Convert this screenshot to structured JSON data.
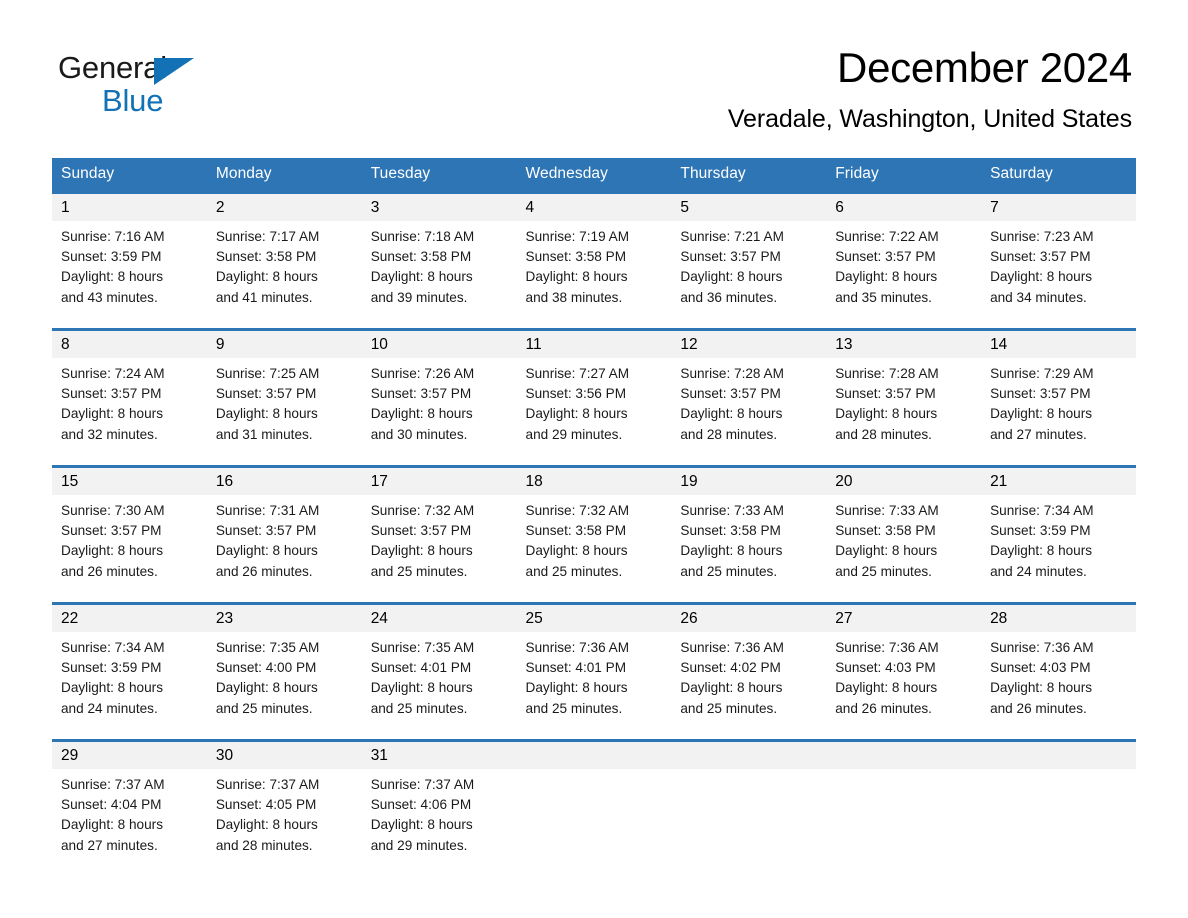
{
  "logo": {
    "word1": "General",
    "word2": "Blue",
    "triangle_color": "#1371b5"
  },
  "header": {
    "title": "December 2024",
    "location": "Veradale, Washington, United States"
  },
  "theme": {
    "header_blue": "#2e75b6",
    "daynum_gray": "#f2f2f2",
    "text_black": "#000000"
  },
  "calendar": {
    "weekday_headers": [
      "Sunday",
      "Monday",
      "Tuesday",
      "Wednesday",
      "Thursday",
      "Friday",
      "Saturday"
    ],
    "weeks": [
      [
        {
          "day": "1",
          "sunrise": "Sunrise: 7:16 AM",
          "sunset": "Sunset: 3:59 PM",
          "daylight1": "Daylight: 8 hours",
          "daylight2": "and 43 minutes."
        },
        {
          "day": "2",
          "sunrise": "Sunrise: 7:17 AM",
          "sunset": "Sunset: 3:58 PM",
          "daylight1": "Daylight: 8 hours",
          "daylight2": "and 41 minutes."
        },
        {
          "day": "3",
          "sunrise": "Sunrise: 7:18 AM",
          "sunset": "Sunset: 3:58 PM",
          "daylight1": "Daylight: 8 hours",
          "daylight2": "and 39 minutes."
        },
        {
          "day": "4",
          "sunrise": "Sunrise: 7:19 AM",
          "sunset": "Sunset: 3:58 PM",
          "daylight1": "Daylight: 8 hours",
          "daylight2": "and 38 minutes."
        },
        {
          "day": "5",
          "sunrise": "Sunrise: 7:21 AM",
          "sunset": "Sunset: 3:57 PM",
          "daylight1": "Daylight: 8 hours",
          "daylight2": "and 36 minutes."
        },
        {
          "day": "6",
          "sunrise": "Sunrise: 7:22 AM",
          "sunset": "Sunset: 3:57 PM",
          "daylight1": "Daylight: 8 hours",
          "daylight2": "and 35 minutes."
        },
        {
          "day": "7",
          "sunrise": "Sunrise: 7:23 AM",
          "sunset": "Sunset: 3:57 PM",
          "daylight1": "Daylight: 8 hours",
          "daylight2": "and 34 minutes."
        }
      ],
      [
        {
          "day": "8",
          "sunrise": "Sunrise: 7:24 AM",
          "sunset": "Sunset: 3:57 PM",
          "daylight1": "Daylight: 8 hours",
          "daylight2": "and 32 minutes."
        },
        {
          "day": "9",
          "sunrise": "Sunrise: 7:25 AM",
          "sunset": "Sunset: 3:57 PM",
          "daylight1": "Daylight: 8 hours",
          "daylight2": "and 31 minutes."
        },
        {
          "day": "10",
          "sunrise": "Sunrise: 7:26 AM",
          "sunset": "Sunset: 3:57 PM",
          "daylight1": "Daylight: 8 hours",
          "daylight2": "and 30 minutes."
        },
        {
          "day": "11",
          "sunrise": "Sunrise: 7:27 AM",
          "sunset": "Sunset: 3:56 PM",
          "daylight1": "Daylight: 8 hours",
          "daylight2": "and 29 minutes."
        },
        {
          "day": "12",
          "sunrise": "Sunrise: 7:28 AM",
          "sunset": "Sunset: 3:57 PM",
          "daylight1": "Daylight: 8 hours",
          "daylight2": "and 28 minutes."
        },
        {
          "day": "13",
          "sunrise": "Sunrise: 7:28 AM",
          "sunset": "Sunset: 3:57 PM",
          "daylight1": "Daylight: 8 hours",
          "daylight2": "and 28 minutes."
        },
        {
          "day": "14",
          "sunrise": "Sunrise: 7:29 AM",
          "sunset": "Sunset: 3:57 PM",
          "daylight1": "Daylight: 8 hours",
          "daylight2": "and 27 minutes."
        }
      ],
      [
        {
          "day": "15",
          "sunrise": "Sunrise: 7:30 AM",
          "sunset": "Sunset: 3:57 PM",
          "daylight1": "Daylight: 8 hours",
          "daylight2": "and 26 minutes."
        },
        {
          "day": "16",
          "sunrise": "Sunrise: 7:31 AM",
          "sunset": "Sunset: 3:57 PM",
          "daylight1": "Daylight: 8 hours",
          "daylight2": "and 26 minutes."
        },
        {
          "day": "17",
          "sunrise": "Sunrise: 7:32 AM",
          "sunset": "Sunset: 3:57 PM",
          "daylight1": "Daylight: 8 hours",
          "daylight2": "and 25 minutes."
        },
        {
          "day": "18",
          "sunrise": "Sunrise: 7:32 AM",
          "sunset": "Sunset: 3:58 PM",
          "daylight1": "Daylight: 8 hours",
          "daylight2": "and 25 minutes."
        },
        {
          "day": "19",
          "sunrise": "Sunrise: 7:33 AM",
          "sunset": "Sunset: 3:58 PM",
          "daylight1": "Daylight: 8 hours",
          "daylight2": "and 25 minutes."
        },
        {
          "day": "20",
          "sunrise": "Sunrise: 7:33 AM",
          "sunset": "Sunset: 3:58 PM",
          "daylight1": "Daylight: 8 hours",
          "daylight2": "and 25 minutes."
        },
        {
          "day": "21",
          "sunrise": "Sunrise: 7:34 AM",
          "sunset": "Sunset: 3:59 PM",
          "daylight1": "Daylight: 8 hours",
          "daylight2": "and 24 minutes."
        }
      ],
      [
        {
          "day": "22",
          "sunrise": "Sunrise: 7:34 AM",
          "sunset": "Sunset: 3:59 PM",
          "daylight1": "Daylight: 8 hours",
          "daylight2": "and 24 minutes."
        },
        {
          "day": "23",
          "sunrise": "Sunrise: 7:35 AM",
          "sunset": "Sunset: 4:00 PM",
          "daylight1": "Daylight: 8 hours",
          "daylight2": "and 25 minutes."
        },
        {
          "day": "24",
          "sunrise": "Sunrise: 7:35 AM",
          "sunset": "Sunset: 4:01 PM",
          "daylight1": "Daylight: 8 hours",
          "daylight2": "and 25 minutes."
        },
        {
          "day": "25",
          "sunrise": "Sunrise: 7:36 AM",
          "sunset": "Sunset: 4:01 PM",
          "daylight1": "Daylight: 8 hours",
          "daylight2": "and 25 minutes."
        },
        {
          "day": "26",
          "sunrise": "Sunrise: 7:36 AM",
          "sunset": "Sunset: 4:02 PM",
          "daylight1": "Daylight: 8 hours",
          "daylight2": "and 25 minutes."
        },
        {
          "day": "27",
          "sunrise": "Sunrise: 7:36 AM",
          "sunset": "Sunset: 4:03 PM",
          "daylight1": "Daylight: 8 hours",
          "daylight2": "and 26 minutes."
        },
        {
          "day": "28",
          "sunrise": "Sunrise: 7:36 AM",
          "sunset": "Sunset: 4:03 PM",
          "daylight1": "Daylight: 8 hours",
          "daylight2": "and 26 minutes."
        }
      ],
      [
        {
          "day": "29",
          "sunrise": "Sunrise: 7:37 AM",
          "sunset": "Sunset: 4:04 PM",
          "daylight1": "Daylight: 8 hours",
          "daylight2": "and 27 minutes."
        },
        {
          "day": "30",
          "sunrise": "Sunrise: 7:37 AM",
          "sunset": "Sunset: 4:05 PM",
          "daylight1": "Daylight: 8 hours",
          "daylight2": "and 28 minutes."
        },
        {
          "day": "31",
          "sunrise": "Sunrise: 7:37 AM",
          "sunset": "Sunset: 4:06 PM",
          "daylight1": "Daylight: 8 hours",
          "daylight2": "and 29 minutes."
        },
        {
          "day": "",
          "sunrise": "",
          "sunset": "",
          "daylight1": "",
          "daylight2": ""
        },
        {
          "day": "",
          "sunrise": "",
          "sunset": "",
          "daylight1": "",
          "daylight2": ""
        },
        {
          "day": "",
          "sunrise": "",
          "sunset": "",
          "daylight1": "",
          "daylight2": ""
        },
        {
          "day": "",
          "sunrise": "",
          "sunset": "",
          "daylight1": "",
          "daylight2": ""
        }
      ]
    ]
  }
}
